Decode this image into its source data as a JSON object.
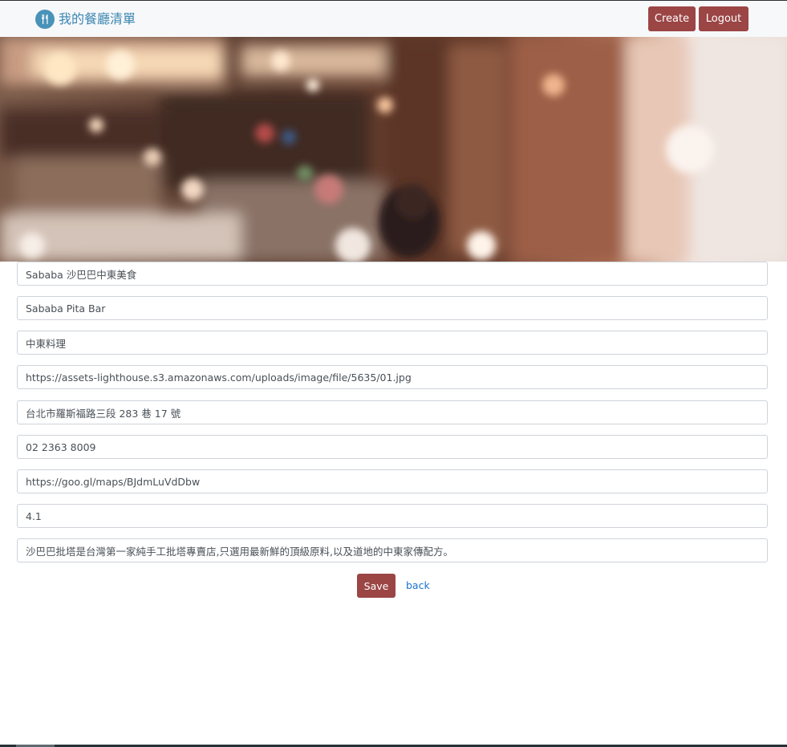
{
  "navbar": {
    "brand_icon": "utensils-icon",
    "brand_title": "我的餐廳清單",
    "create_label": "Create",
    "logout_label": "Logout",
    "brand_color": "#3b86b0",
    "button_color": "#9b4545"
  },
  "banner": {
    "image": "blurred restaurant interior photo"
  },
  "form": {
    "name": "Sababa 沙巴巴中東美食",
    "name_en": "Sababa Pita Bar",
    "category": "中東料理",
    "image_url": "https://assets-lighthouse.s3.amazonaws.com/uploads/image/file/5635/01.jpg",
    "location": "台北市羅斯福路三段 283 巷 17 號",
    "phone": "02 2363 8009",
    "google_map": "https://goo.gl/maps/BJdmLuVdDbw",
    "rating": "4.1",
    "description": "沙巴巴批塔是台灣第一家純手工批塔專賣店,只選用最新鮮的頂級原料,以及道地的中東家傳配方。",
    "save_label": "Save",
    "back_label": "back"
  }
}
